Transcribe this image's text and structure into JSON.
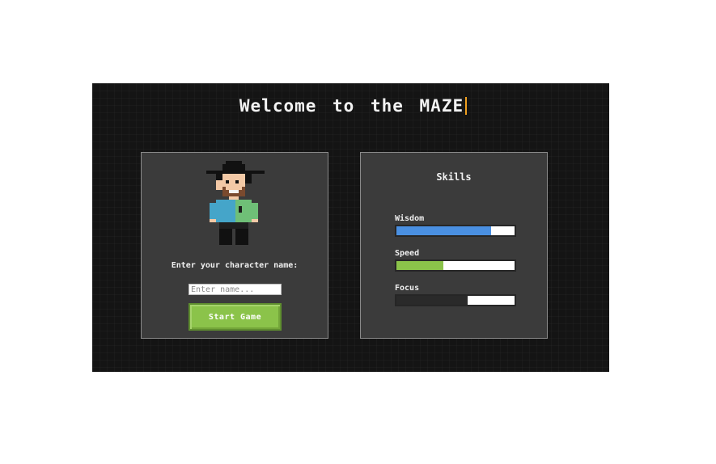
{
  "title": "Welcome to the MAZE",
  "character": {
    "prompt": "Enter your character name:",
    "name_value": "",
    "name_placeholder": "Enter name...",
    "start_label": "Start Game",
    "avatar_icon": "pixel-character-icon"
  },
  "skills": {
    "title": "Skills",
    "items": [
      {
        "label": "Wisdom",
        "level": 0.8,
        "color": "#4a90e2"
      },
      {
        "label": "Speed",
        "level": 0.4,
        "color": "#8bc34a"
      },
      {
        "label": "Focus",
        "level": 0.6,
        "color": "#2a2a2a"
      }
    ]
  },
  "colors": {
    "accent_button": "#8bc34a",
    "caret": "#f0a020"
  }
}
